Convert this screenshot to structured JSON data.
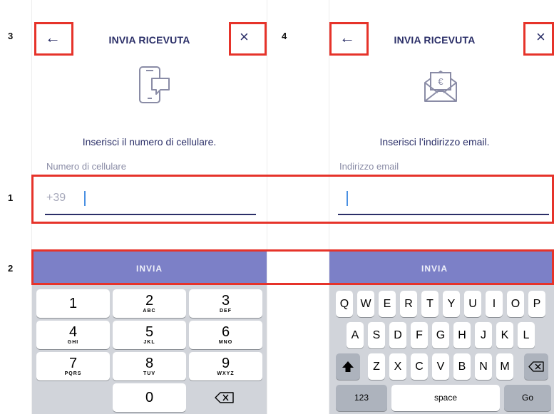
{
  "callouts": {
    "c1": "1",
    "c2": "2",
    "c3": "3",
    "c4": "4"
  },
  "screens": {
    "phone": {
      "title": "INVIA RICEVUTA",
      "back_icon": "←",
      "close_icon": "×",
      "prompt": "Inserisci il numero di cellulare.",
      "field_label": "Numero di cellulare",
      "prefix": "+39",
      "send_label": "INVIA"
    },
    "email": {
      "title": "INVIA RICEVUTA",
      "back_icon": "←",
      "close_icon": "×",
      "prompt": "Inserisci l’indirizzo email.",
      "field_label": "Indirizzo email",
      "send_label": "INVIA"
    }
  },
  "numpad": {
    "k1": {
      "d": "1",
      "l": ""
    },
    "k2": {
      "d": "2",
      "l": "ABC"
    },
    "k3": {
      "d": "3",
      "l": "DEF"
    },
    "k4": {
      "d": "4",
      "l": "GHI"
    },
    "k5": {
      "d": "5",
      "l": "JKL"
    },
    "k6": {
      "d": "6",
      "l": "MNO"
    },
    "k7": {
      "d": "7",
      "l": "PQRS"
    },
    "k8": {
      "d": "8",
      "l": "TUV"
    },
    "k9": {
      "d": "9",
      "l": "WXYZ"
    },
    "k0": {
      "d": "0",
      "l": ""
    }
  },
  "keyboard": {
    "row1": [
      "Q",
      "W",
      "E",
      "R",
      "T",
      "Y",
      "U",
      "I",
      "O",
      "P"
    ],
    "row2": [
      "A",
      "S",
      "D",
      "F",
      "G",
      "H",
      "J",
      "K",
      "L"
    ],
    "row3": [
      "Z",
      "X",
      "C",
      "V",
      "B",
      "N",
      "M"
    ],
    "numbers_key": "123",
    "space_key": "space",
    "go_key": "Go"
  },
  "colors": {
    "brand": "#2b2f68",
    "send_button": "#7c80c7",
    "highlight": "#e6332a",
    "keyboard_bg": "#d1d4da"
  }
}
